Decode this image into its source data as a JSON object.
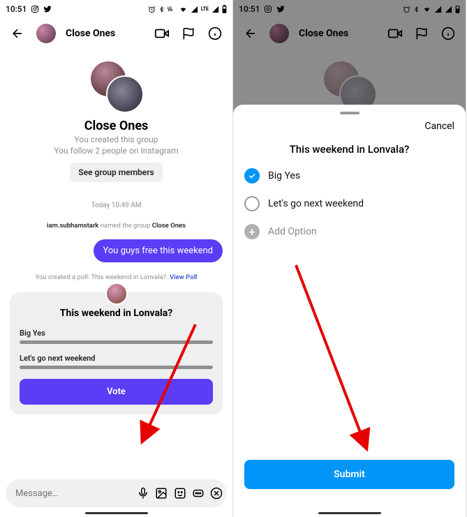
{
  "status": {
    "time": "10:51",
    "battery_signal": "LTE"
  },
  "left": {
    "header": {
      "title": "Close Ones"
    },
    "group": {
      "name": "Close Ones",
      "subtitle1": "You created this group",
      "subtitle2": "You follow 2 people on Instagram",
      "members_button": "See group members"
    },
    "timestamp": "Today 10:49 AM",
    "system": {
      "user": "iam.subhamstark",
      "mid": " named the group ",
      "group": "Close Ones"
    },
    "bubble": "You guys free this weekend",
    "poll_created": {
      "prefix": "You created a poll: This weekend in Lonvala?. ",
      "link": "View Poll"
    },
    "poll": {
      "question": "This weekend in Lonvala?",
      "opt1": "Big Yes",
      "opt2": "Let's go next weekend",
      "vote": "Vote"
    },
    "composer": {
      "placeholder": "Message…"
    }
  },
  "right": {
    "cancel": "Cancel",
    "question": "This weekend in Lonvala?",
    "opt1": "Big Yes",
    "opt2": "Let's go next weekend",
    "add": "Add Option",
    "submit": "Submit"
  }
}
